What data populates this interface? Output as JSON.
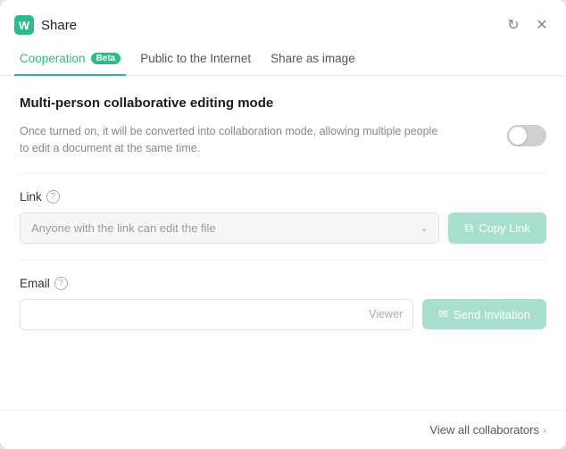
{
  "window": {
    "title": "Share"
  },
  "tabs": [
    {
      "id": "cooperation",
      "label": "Cooperation",
      "badge": "Beta",
      "active": true
    },
    {
      "id": "public",
      "label": "Public to the Internet",
      "active": false
    },
    {
      "id": "share-image",
      "label": "Share as image",
      "active": false
    }
  ],
  "collaboration": {
    "title": "Multi-person collaborative editing mode",
    "description": "Once turned on, it will be converted into collaboration mode, allowing multiple people to edit a document at the same time.",
    "toggle_enabled": false
  },
  "link_section": {
    "label": "Link",
    "select_placeholder": "Anyone with the link can edit the file",
    "copy_button_label": "Copy Link"
  },
  "email_section": {
    "label": "Email",
    "viewer_label": "Viewer",
    "send_button_label": "Send Invitation"
  },
  "footer": {
    "view_all_label": "View all collaborators"
  },
  "icons": {
    "app": "W",
    "refresh": "↻",
    "close": "✕",
    "help": "?",
    "copy": "⧉",
    "send": "✉",
    "chevron_right": "›",
    "chevron_down": "∨"
  }
}
